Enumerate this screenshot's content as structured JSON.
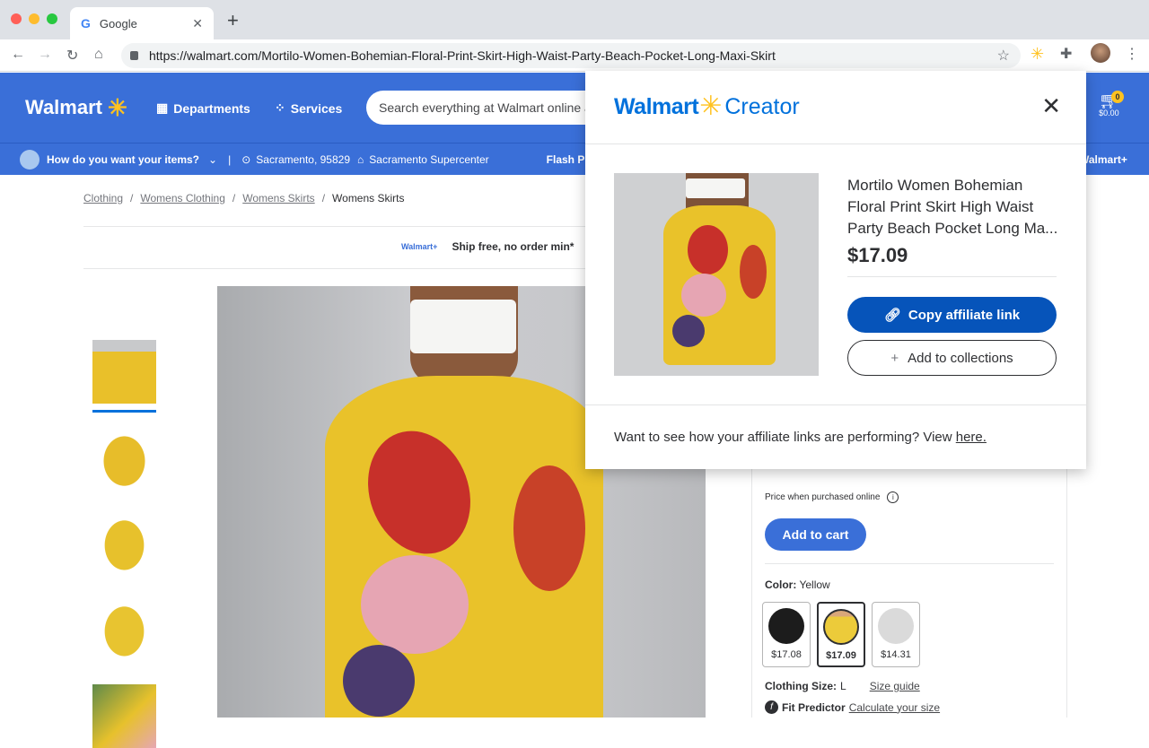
{
  "browser": {
    "tab_title": "Google",
    "tab_icon": "google-g-icon",
    "new_tab": "+",
    "url": "https://walmart.com/Mortilo-Women-Bohemian-Floral-Print-Skirt-High-Waist-Party-Beach-Pocket-Long-Maxi-Skirt"
  },
  "header": {
    "logo": "Walmart",
    "departments": "Departments",
    "services": "Services",
    "search_placeholder": "Search everything at Walmart online and in store",
    "cart_count": "0",
    "cart_total": "$0.00"
  },
  "subheader": {
    "fulfillment": "How do you want your items?",
    "location": "Sacramento, 95829",
    "store": "Sacramento Supercenter",
    "flash": "Flash Picks",
    "walmart_plus": "Walmart+"
  },
  "breadcrumb": [
    "Clothing",
    "Womens Clothing",
    "Womens Skirts",
    "Womens Skirts"
  ],
  "ship_banner": {
    "badge": "Walmart+",
    "text": "Ship free, no order min*"
  },
  "buybox": {
    "price_note": "Price when purchased online",
    "add_to_cart": "Add to cart",
    "color_label": "Color:",
    "color_value": "Yellow",
    "swatches": [
      {
        "price": "$17.08",
        "color": "#1c1c1c"
      },
      {
        "price": "$17.09",
        "color": "#f0c531",
        "selected": true
      },
      {
        "price": "$14.31",
        "color": "#dadada"
      }
    ],
    "size_label": "Clothing Size:",
    "size_value": "L",
    "size_guide": "Size guide",
    "fit_predictor": "Fit Predictor",
    "calculate": "Calculate your size"
  },
  "popup": {
    "brand": "Walmart",
    "product": "Creator",
    "title": "Mortilo Women Bohemian Floral Print Skirt High Waist Party Beach Pocket Long Ma...",
    "price": "$17.09",
    "copy_link": "Copy affiliate link",
    "add_collections": "Add to collections",
    "footer_text": "Want to see how your affiliate links are performing? View ",
    "footer_link": "here."
  }
}
